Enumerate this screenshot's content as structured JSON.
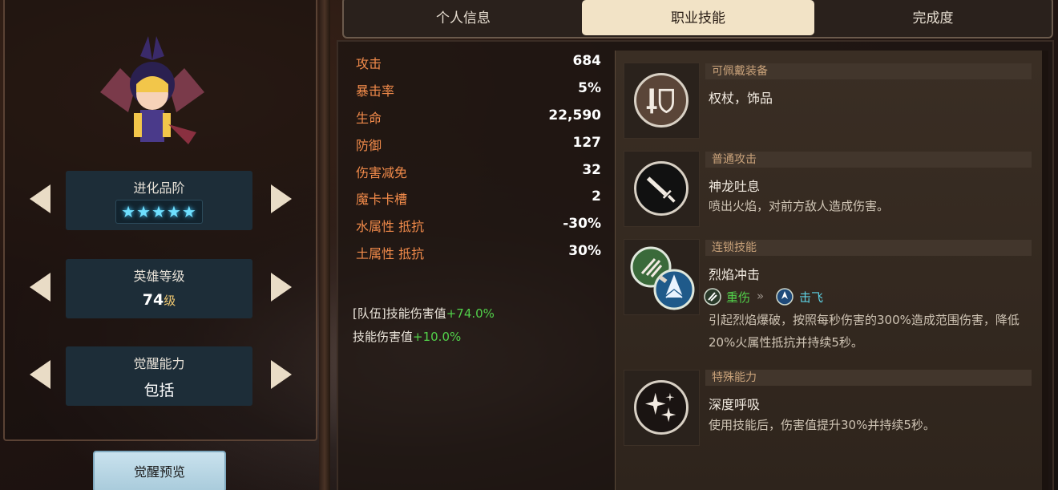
{
  "tabs": [
    "个人信息",
    "职业技能",
    "完成度"
  ],
  "active_tab_index": 1,
  "left": {
    "evolution": {
      "label": "进化品阶",
      "stars": "★★★★★",
      "star_count": 5
    },
    "hero_level": {
      "label": "英雄等级",
      "value": "74",
      "unit": "级"
    },
    "awakening": {
      "label": "觉醒能力",
      "value": "包括"
    },
    "awaken_preview_button": "觉醒预览"
  },
  "stats": [
    {
      "name": "攻击",
      "value": "684"
    },
    {
      "name": "暴击率",
      "value": "5%"
    },
    {
      "name": "生命",
      "value": "22,590"
    },
    {
      "name": "防御",
      "value": "127"
    },
    {
      "name": "伤害减免",
      "value": "32"
    },
    {
      "name": "魔卡卡槽",
      "value": "2"
    },
    {
      "name": "水属性 抵抗",
      "value": "-30%"
    },
    {
      "name": "土属性 抵抗",
      "value": "30%"
    }
  ],
  "bonuses": {
    "team_label": "[队伍]技能伤害值",
    "team_value": "+74.0%",
    "skill_label": "技能伤害值",
    "skill_value": "+10.0%"
  },
  "skills": {
    "equipment": {
      "header": "可佩戴装备",
      "name": "权杖，饰品"
    },
    "normal_attack": {
      "header": "普通攻击",
      "name": "神龙吐息",
      "desc": "喷出火焰，对前方敌人造成伤害。"
    },
    "chain": {
      "header": "连锁技能",
      "name": "烈焰冲击",
      "from_tag": "重伤",
      "to_tag": "击飞",
      "desc": "引起烈焰爆破，按照每秒伤害的300%造成范围伤害，降低20%火属性抵抗并持续5秒。"
    },
    "special": {
      "header": "特殊能力",
      "name": "深度呼吸",
      "desc": "使用技能后，伤害值提升30%并持续5秒。"
    }
  },
  "colors": {
    "stat_key": "#f08a4a",
    "bonus_green": "#52d14a",
    "tag_from": "#52d14a",
    "tag_to": "#5ed3e6"
  }
}
